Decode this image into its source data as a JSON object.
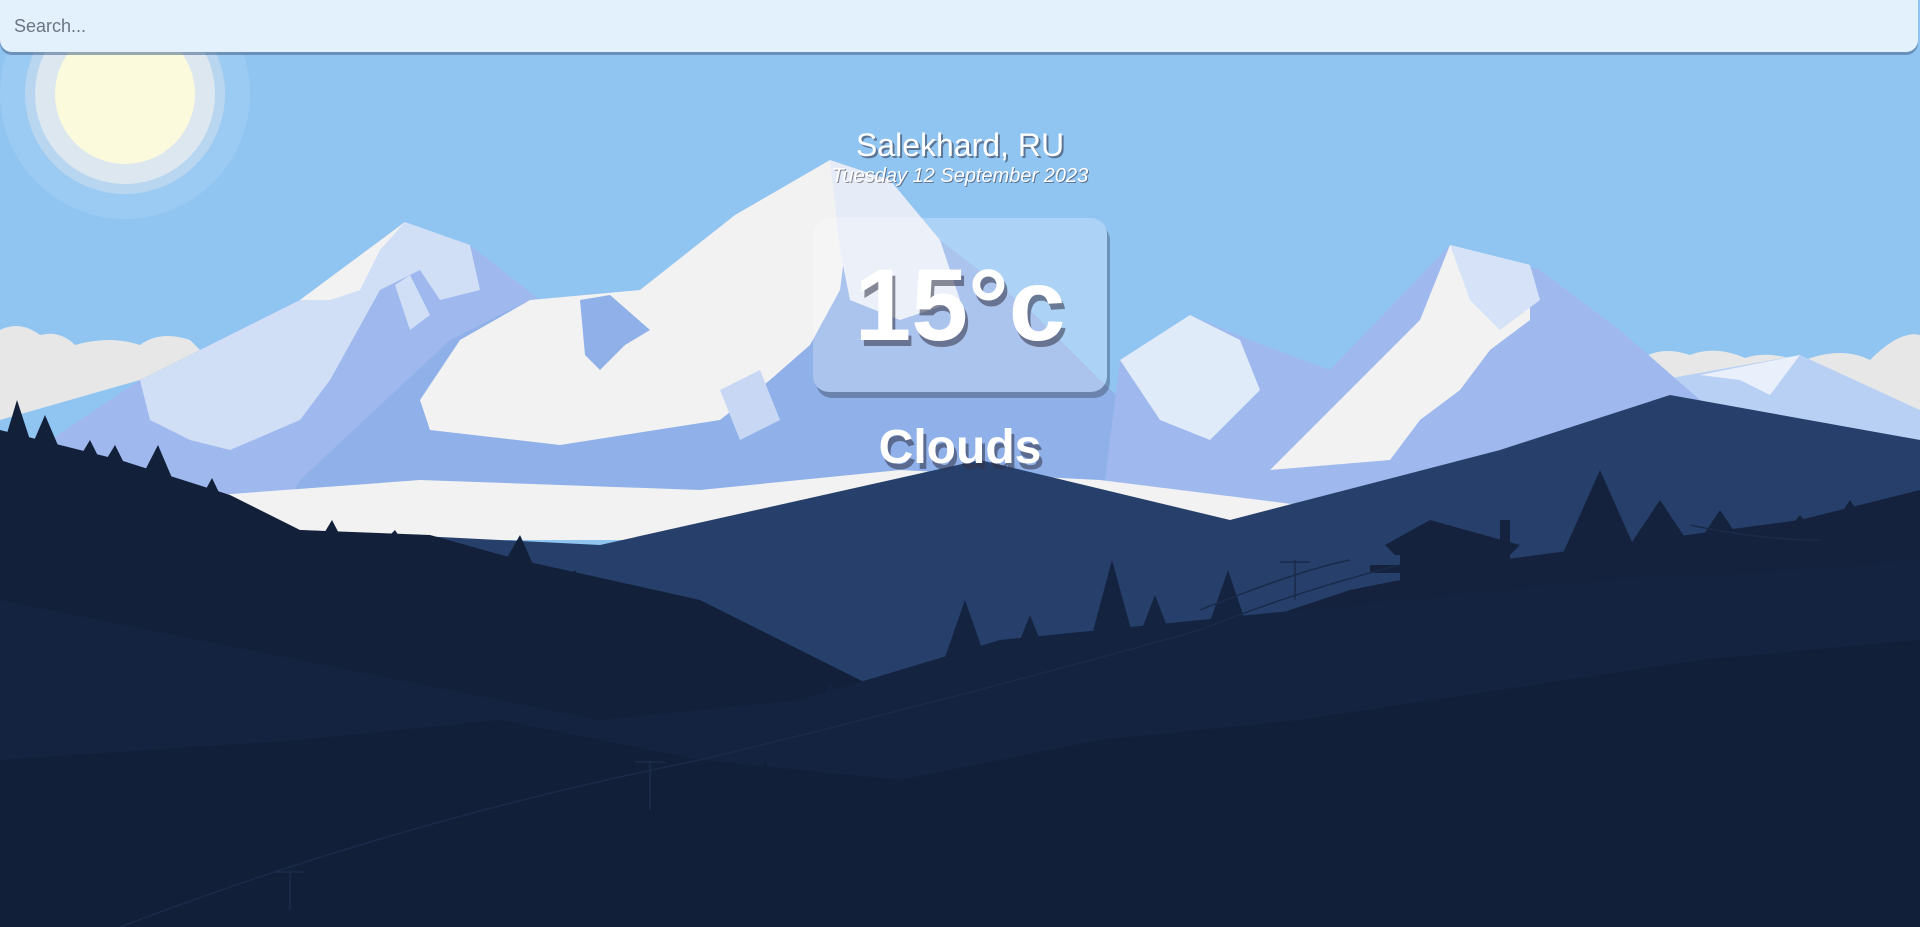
{
  "search": {
    "placeholder": "Search...",
    "value": ""
  },
  "location": {
    "city_country": "Salekhard, RU",
    "date": "Tuesday 12 September 2023"
  },
  "weather": {
    "temperature": "15°c",
    "condition": "Clouds"
  },
  "background": {
    "scene": "mountain-landscape",
    "colors": {
      "sky": "#90c5f2",
      "sun": "#fbfadc",
      "snow": "#f2f2f2",
      "ice_blue": "#9fb9ee",
      "mid_mountain": "#27406b",
      "forest_dark": "#12203a"
    }
  }
}
